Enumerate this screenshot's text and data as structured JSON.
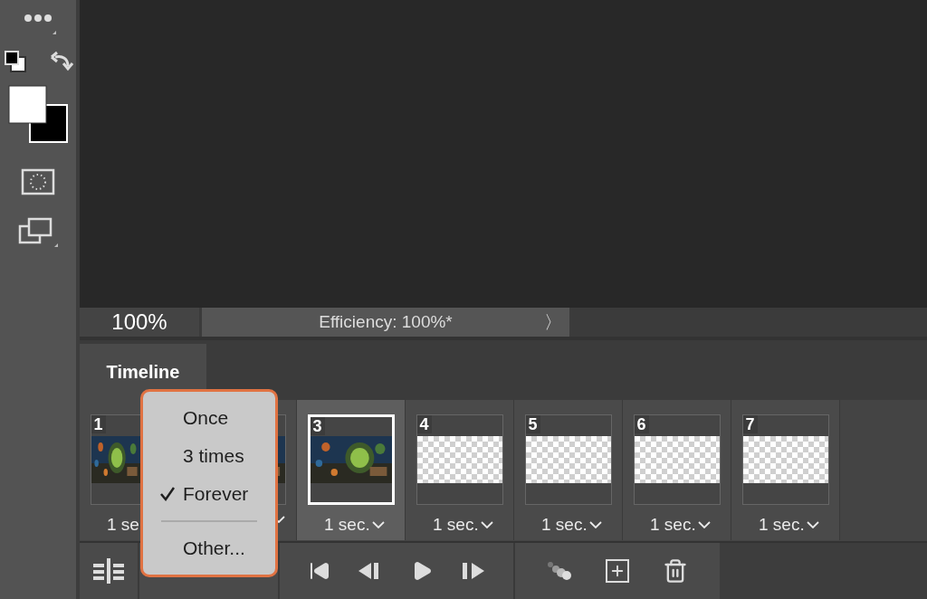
{
  "status_bar": {
    "zoom": "100%",
    "info": "Efficiency: 100%*",
    "arrow": "〉"
  },
  "panel": {
    "tab": "Timeline"
  },
  "frames": [
    {
      "number": "1",
      "delay": "1 se",
      "selected": false,
      "kind": "picture"
    },
    {
      "selected": false,
      "kind": "picture"
    },
    {
      "number": "3",
      "delay": "1 sec.",
      "selected": true,
      "kind": "picture"
    },
    {
      "number": "4",
      "delay": "1 sec.",
      "selected": false,
      "kind": "transparent"
    },
    {
      "number": "5",
      "delay": "1 sec.",
      "selected": false,
      "kind": "transparent"
    },
    {
      "number": "6",
      "delay": "1 sec.",
      "selected": false,
      "kind": "transparent"
    },
    {
      "number": "7",
      "delay": "1 sec.",
      "selected": false,
      "kind": "transparent"
    }
  ],
  "loop_menu": [
    {
      "kind": "item",
      "label": "Once",
      "checked": false
    },
    {
      "kind": "item",
      "label": "3 times",
      "checked": false
    },
    {
      "kind": "item",
      "label": "Forever",
      "checked": true
    },
    {
      "kind": "separator"
    },
    {
      "kind": "item",
      "label": "Other...",
      "checked": false
    }
  ]
}
